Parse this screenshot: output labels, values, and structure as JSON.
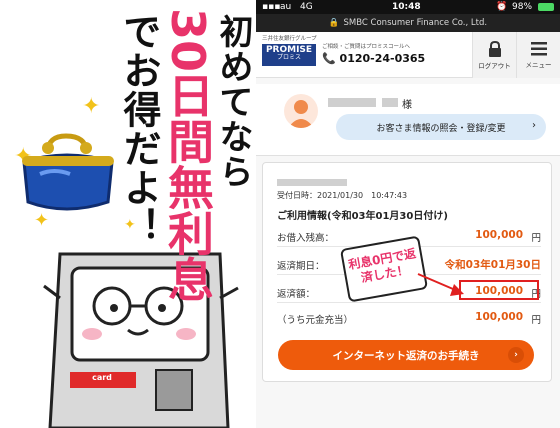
{
  "illustration": {
    "column1": "初めてなら",
    "column2": "30日間無利息",
    "column3": "でお得だよ！",
    "card_label": "card"
  },
  "status_bar": {
    "carrier": "au",
    "network": "4G",
    "time": "10:48",
    "battery": "98%"
  },
  "url_bar": {
    "site": "SMBC Consumer Finance Co., Ltd."
  },
  "header": {
    "group_label": "三井住友銀行グループ",
    "logo_main": "PROMISE",
    "logo_sub": "プロミス",
    "caption": "ご相談・ご質問はプロミスコールへ",
    "phone": "0120-24-0365",
    "logout_label": "ログアウト",
    "menu_label": "メニュー"
  },
  "user": {
    "honorific": "様",
    "inquiry_button": "お客さま情報の照会・登録/変更"
  },
  "receipt": {
    "date_line": "受付日時：2021/01/30　10:47:43",
    "title": "ご利用情報(令和03年01月30日付け)",
    "rows": [
      {
        "label": "お借入残高：",
        "value": "100,000",
        "unit": "円"
      },
      {
        "label": "返済期日：",
        "value": "令和03年01月30日",
        "unit": ""
      },
      {
        "label": "返済額：",
        "value": "100,000",
        "unit": "円"
      },
      {
        "label": "（うち元金充当）",
        "value": "100,000",
        "unit": "円"
      }
    ],
    "callout": "利息0円で返済した！",
    "repay_button": "インターネット返済のお手続き"
  },
  "colors": {
    "accent_pink": "#e8336a",
    "orange": "#ee5b0c",
    "navy": "#1f3f8a",
    "highlight_red": "#e02020"
  }
}
